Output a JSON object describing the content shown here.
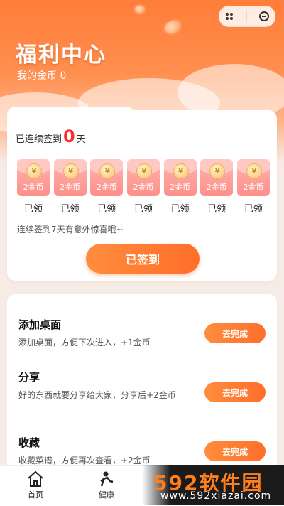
{
  "header": {
    "title": "福利中心",
    "balance": "我的金币 0"
  },
  "checkin": {
    "streak_prefix": "已连续签到",
    "streak_count": "0",
    "streak_suffix": "天",
    "envelopes": [
      {
        "coin_symbol": "¥",
        "amount": "2金币",
        "status": "已领"
      },
      {
        "coin_symbol": "¥",
        "amount": "2金币",
        "status": "已领"
      },
      {
        "coin_symbol": "¥",
        "amount": "2金币",
        "status": "已领"
      },
      {
        "coin_symbol": "¥",
        "amount": "2金币",
        "status": "已领"
      },
      {
        "coin_symbol": "¥",
        "amount": "2金币",
        "status": "已领"
      },
      {
        "coin_symbol": "¥",
        "amount": "2金币",
        "status": "已领"
      },
      {
        "coin_symbol": "¥",
        "amount": "2金币",
        "status": "已领"
      }
    ],
    "hint": "连续签到7天有意外惊喜哦~",
    "button_label": "已签到"
  },
  "tasks": [
    {
      "title": "添加桌面",
      "desc": "添加桌面，方便下次进入，+1金币",
      "button": "去完成"
    },
    {
      "title": "分享",
      "desc": "好的东西就要分享给大家，分享后+2金币",
      "button": "去完成"
    },
    {
      "title": "收藏",
      "desc": "收藏菜谱，方便再次查看，+2金币",
      "button": "去完成"
    }
  ],
  "tabbar": {
    "home": "首页",
    "health": "健康"
  },
  "watermark": {
    "logo": "592软件园",
    "url": "www.592xiazai.com"
  },
  "colors": {
    "accent": "#ff6e2a",
    "streak_number": "#ff2b2b",
    "envelope": "#ff8f8a"
  }
}
